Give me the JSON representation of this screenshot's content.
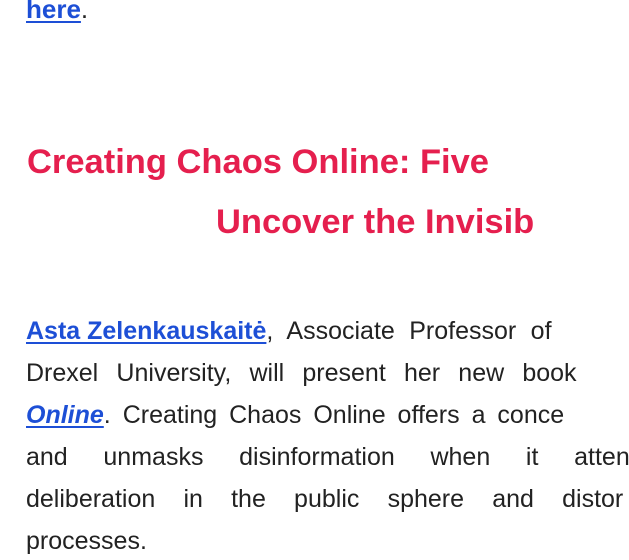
{
  "intro_fragment": {
    "link_text": "here",
    "trailing": "."
  },
  "article": {
    "title_line1": "Creating Chaos Online: Five",
    "title_line2": "Uncover the Invisib",
    "author_link": "Asta Zelenkauskaitė",
    "line1_rest": ", Associate Professor of",
    "line2": "Drexel University, will present her new book",
    "book_link": "Online",
    "line3_rest": ". Creating Chaos Online offers a conce",
    "line4": "and unmasks disinformation when it atten",
    "line5": "deliberation in the public sphere and distor",
    "line6": "processes."
  },
  "colors": {
    "title": "#e51f4e",
    "link": "#1d4fd6",
    "text": "#222222"
  }
}
